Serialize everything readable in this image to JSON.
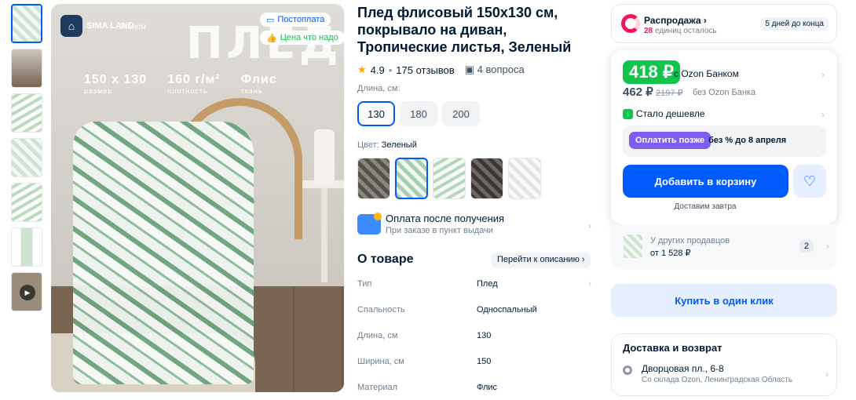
{
  "gallery": {
    "thumbs": 6,
    "big_word": "ПЛЕД",
    "brand": "SIMA LAND",
    "econom": "Эконом",
    "badge_postpay": "Постоплата",
    "badge_price": "Цена что надо",
    "specs": [
      {
        "value": "150 x 130",
        "label": "размер"
      },
      {
        "value": "160 г/м²",
        "label": "плотность"
      },
      {
        "value": "Флис",
        "label": "ткань"
      }
    ]
  },
  "product": {
    "title": "Плед флисовый 150х130 см, покрывало на диван, Тропические листья, Зеленый",
    "rating": "4.9",
    "reviews": "175 отзывов",
    "questions": "4 вопроса",
    "length_label": "Длина, см:",
    "sizes": [
      "130",
      "180",
      "200"
    ],
    "color_label": "Цвет:",
    "color_value": "Зеленый",
    "payment_title": "Оплата после получения",
    "payment_sub": "При заказе в пункт выдачи",
    "about_title": "О товаре",
    "to_description": "Перейти к описанию",
    "props": [
      {
        "k": "Тип",
        "v": "Плед"
      },
      {
        "k": "Спальность",
        "v": "Односпальный"
      },
      {
        "k": "Длина, см",
        "v": "130"
      },
      {
        "k": "Ширина, см",
        "v": "150"
      },
      {
        "k": "Материал",
        "v": "Флис"
      }
    ]
  },
  "buy": {
    "sale_title": "Распродажа",
    "sale_count": "28",
    "sale_left": "единиц осталось",
    "sale_days": "5 дней до конца",
    "ozon_price": "418 ₽",
    "ozon_price_label": "с Ozon Банком",
    "price": "462 ₽",
    "old_price": "2197 ₽",
    "price_label": "без Ozon Банка",
    "cheaper": "Стало дешевле",
    "pay_later": "Оплатить позже",
    "pay_later_text": "без % до 8 апреля",
    "add_cart": "Добавить в корзину",
    "delivery": "Доставим завтра",
    "other_sellers": "У других продавцов",
    "other_price": "от 1 528 ₽",
    "other_count": "2",
    "one_click": "Купить в один клик",
    "delivery_title": "Доставка и возврат",
    "address": "Дворцовая пл., 6-8",
    "address_sub": "Со склада Ozon, Ленинградская Область"
  }
}
